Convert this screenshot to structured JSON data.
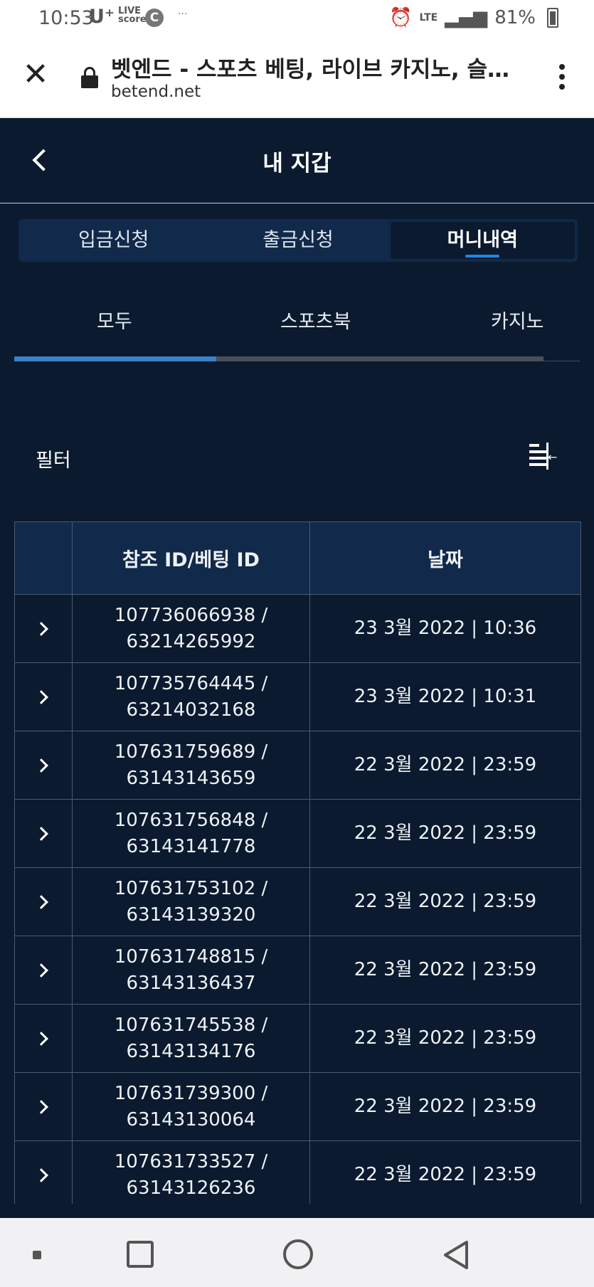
{
  "status_bar": {
    "time": "10:53",
    "carrier": "U⁺",
    "live_badge": "LIVE score",
    "c_badge": "C",
    "dots": "···",
    "battery": "81%"
  },
  "browser": {
    "page_title": "벳엔드 - 스포츠 베팅, 라이브 카지노, 슬롯...",
    "domain": "betend.net"
  },
  "header": {
    "title": "내 지갑"
  },
  "segment_tabs": [
    {
      "label": "입금신청",
      "active": false
    },
    {
      "label": "출금신청",
      "active": false
    },
    {
      "label": "머니내역",
      "active": true
    }
  ],
  "sub_tabs": [
    {
      "label": "모두",
      "active": true
    },
    {
      "label": "스포츠북",
      "active": false
    },
    {
      "label": "카지노",
      "active": false
    }
  ],
  "filter": {
    "label": "필터"
  },
  "table": {
    "headers": [
      "",
      "참조 ID/베팅 ID",
      "날짜"
    ],
    "rows": [
      {
        "ref_id": "107736066938 /",
        "bet_id": "63214265992",
        "date": "23 3월 2022 | 10:36"
      },
      {
        "ref_id": "107735764445 /",
        "bet_id": "63214032168",
        "date": "23 3월 2022 | 10:31"
      },
      {
        "ref_id": "107631759689 /",
        "bet_id": "63143143659",
        "date": "22 3월 2022 | 23:59"
      },
      {
        "ref_id": "107631756848 /",
        "bet_id": "63143141778",
        "date": "22 3월 2022 | 23:59"
      },
      {
        "ref_id": "107631753102 /",
        "bet_id": "63143139320",
        "date": "22 3월 2022 | 23:59"
      },
      {
        "ref_id": "107631748815 /",
        "bet_id": "63143136437",
        "date": "22 3월 2022 | 23:59"
      },
      {
        "ref_id": "107631745538 /",
        "bet_id": "63143134176",
        "date": "22 3월 2022 | 23:59"
      },
      {
        "ref_id": "107631739300 /",
        "bet_id": "63143130064",
        "date": "22 3월 2022 | 23:59"
      },
      {
        "ref_id": "107631733527 /",
        "bet_id": "63143126236",
        "date": "22 3월 2022 | 23:59"
      }
    ]
  },
  "colors": {
    "background": "#0b1a2e",
    "panel": "#11294a",
    "accent": "#1e88e5"
  }
}
